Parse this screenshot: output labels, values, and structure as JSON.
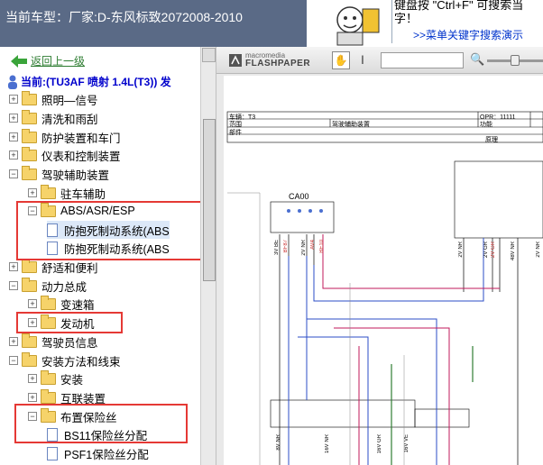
{
  "topbar": {
    "car_label": "当前车型：厂家:D-东风标致2072008-2010",
    "tip_line1": "键盘按 \"Ctrl+F\" 可搜索当",
    "tip_line2": "字！",
    "tip_link": ">>菜单关键字搜索演示"
  },
  "tree": {
    "back_label": "返回上一级",
    "current": "当前:(TU3AF 喷射 1.4L(T3)) 发",
    "items": [
      {
        "label": "照明—信号",
        "pm": "+",
        "icon": "folder"
      },
      {
        "label": "清洗和雨刮",
        "pm": "+",
        "icon": "folder"
      },
      {
        "label": "防护装置和车门",
        "pm": "+",
        "icon": "folder"
      },
      {
        "label": "仪表和控制装置",
        "pm": "+",
        "icon": "folder"
      },
      {
        "label": "驾驶辅助装置",
        "pm": "−",
        "icon": "folder"
      },
      {
        "label": "驻车辅助",
        "pm": "+",
        "icon": "folder"
      },
      {
        "label": "ABS/ASR/ESP",
        "pm": "−",
        "icon": "folder"
      },
      {
        "label": "防抱死制动系统(ABS",
        "pm": "",
        "icon": "doc"
      },
      {
        "label": "防抱死制动系统(ABS",
        "pm": "",
        "icon": "doc"
      },
      {
        "label": "舒适和便利",
        "pm": "+",
        "icon": "folder"
      },
      {
        "label": "动力总成",
        "pm": "−",
        "icon": "folder"
      },
      {
        "label": "变速箱",
        "pm": "+",
        "icon": "folder"
      },
      {
        "label": "发动机",
        "pm": "+",
        "icon": "folder"
      },
      {
        "label": "驾驶员信息",
        "pm": "+",
        "icon": "folder"
      },
      {
        "label": "安装方法和线束",
        "pm": "−",
        "icon": "folder"
      },
      {
        "label": "安装",
        "pm": "+",
        "icon": "folder"
      },
      {
        "label": "互联装置",
        "pm": "+",
        "icon": "folder"
      },
      {
        "label": "布置保险丝",
        "pm": "−",
        "icon": "folder"
      },
      {
        "label": "BS11保险丝分配",
        "pm": "",
        "icon": "doc"
      },
      {
        "label": "PSF1保险丝分配",
        "pm": "",
        "icon": "doc"
      }
    ]
  },
  "viewer": {
    "logo_small": "macromedia",
    "logo_big": "FLASHPAPER",
    "header": {
      "cell_vehicle": "车辆：T3",
      "cell_opr": "OPR：11111",
      "cell_scope": "范围",
      "cell_system": "驾驶辅助装置",
      "cell_function": "功能",
      "cell_part": "部件",
      "cell_schematic": "原理"
    },
    "component": "CA00",
    "wires_top": [
      "3V BE",
      "BF87",
      "2V NR",
      "AV4",
      "BE10"
    ],
    "wires_right": [
      "2V NR",
      "2V GR",
      "2V GR",
      "48V NR",
      "2V NR"
    ],
    "wires_bottom": [
      "8V NR",
      "16V NR",
      "16V GR",
      "16V VE"
    ]
  },
  "colors": {
    "accent_red": "#e53935",
    "topbar": "#5a6a86",
    "link": "#0033cc"
  }
}
